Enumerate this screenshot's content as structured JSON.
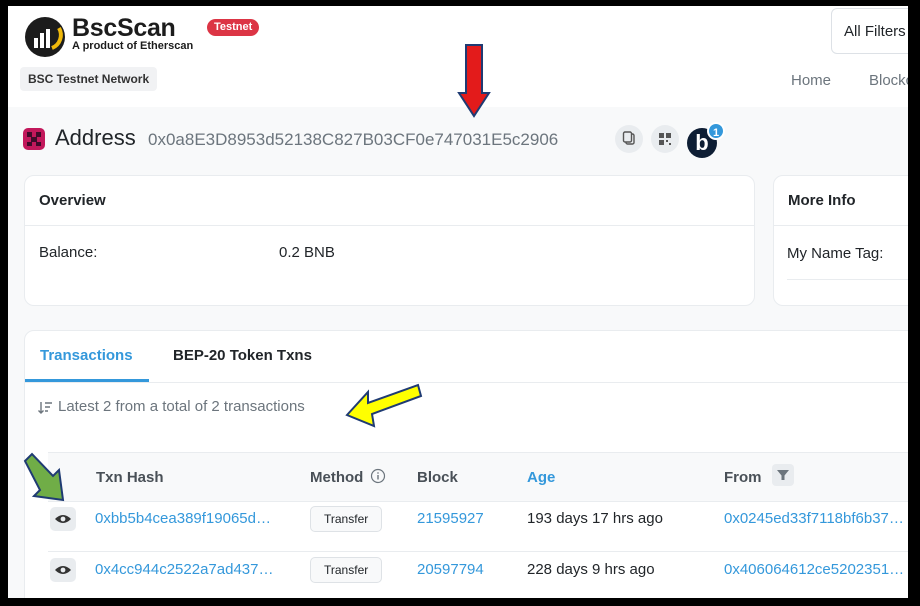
{
  "header": {
    "brand_name": "BscScan",
    "brand_tagline": "A product of Etherscan",
    "testnet_badge": "Testnet",
    "network_label": "BSC Testnet Network",
    "search_filter": "All Filters",
    "nav": {
      "home": "Home",
      "blockchain": "Blockch"
    }
  },
  "address": {
    "title": "Address",
    "hash": "0x0a8E3D8953d52138C827B03CF0e747031E5c2906",
    "badge_letter": "b",
    "badge_count": "1"
  },
  "overview": {
    "title": "Overview",
    "balance_label": "Balance:",
    "balance_value": "0.2 BNB"
  },
  "more_info": {
    "title": "More Info",
    "name_tag_label": "My Name Tag:"
  },
  "tabs": {
    "transactions": "Transactions",
    "bep20": "BEP-20 Token Txns"
  },
  "summary": "Latest 2 from a total of 2 transactions",
  "table": {
    "headers": {
      "txn_hash": "Txn Hash",
      "method": "Method",
      "block": "Block",
      "age": "Age",
      "from": "From"
    },
    "rows": [
      {
        "hash": "0xbb5b4cea389f19065d…",
        "method": "Transfer",
        "block": "21595927",
        "age": "193 days 17 hrs ago",
        "from": "0x0245ed33f7118bf6b37…"
      },
      {
        "hash": "0x4cc944c2522a7ad437…",
        "method": "Transfer",
        "block": "20597794",
        "age": "228 days 9 hrs ago",
        "from": "0x406064612ce5202351…"
      }
    ]
  },
  "colors": {
    "accent": "#3498db",
    "testnet_red": "#dc3545",
    "annotation_red": "#e31b1b",
    "annotation_yellow": "#ffff00",
    "annotation_green": "#70ad47"
  }
}
